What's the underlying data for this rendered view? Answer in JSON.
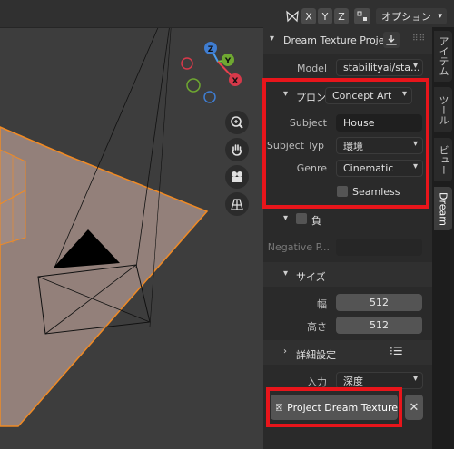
{
  "header": {
    "axis_x": "X",
    "axis_y": "Y",
    "axis_z": "Z",
    "options_label": "オプション"
  },
  "gizmo": {
    "z": "Z",
    "y": "Y",
    "x": "X"
  },
  "panel": {
    "title": "Dream Texture Project",
    "model_label": "Model",
    "model_value": "stabilityai/sta...",
    "prompt_section": {
      "title": "プロン",
      "preset": "Concept Art",
      "subject_label": "Subject",
      "subject_value": "House",
      "subject_type_label": "Subject Typ",
      "subject_type_value": "環境",
      "genre_label": "Genre",
      "genre_value": "Cinematic",
      "seamless_label": "Seamless"
    },
    "negative_section": {
      "title": "負",
      "negative_label": "Negative P..."
    },
    "size_section": {
      "title": "サイズ",
      "width_label": "幅",
      "width_value": "512",
      "height_label": "高さ",
      "height_value": "512"
    },
    "advanced_section": {
      "title": "詳細設定"
    },
    "input_label": "入力",
    "input_value": "深度",
    "project_button": "Project Dream Texture"
  },
  "tabs": [
    "アイテム",
    "ツール",
    "ビュー",
    "Dream"
  ],
  "colors": {
    "highlight": "#e8151b",
    "selection_orange": "#f08a24"
  }
}
